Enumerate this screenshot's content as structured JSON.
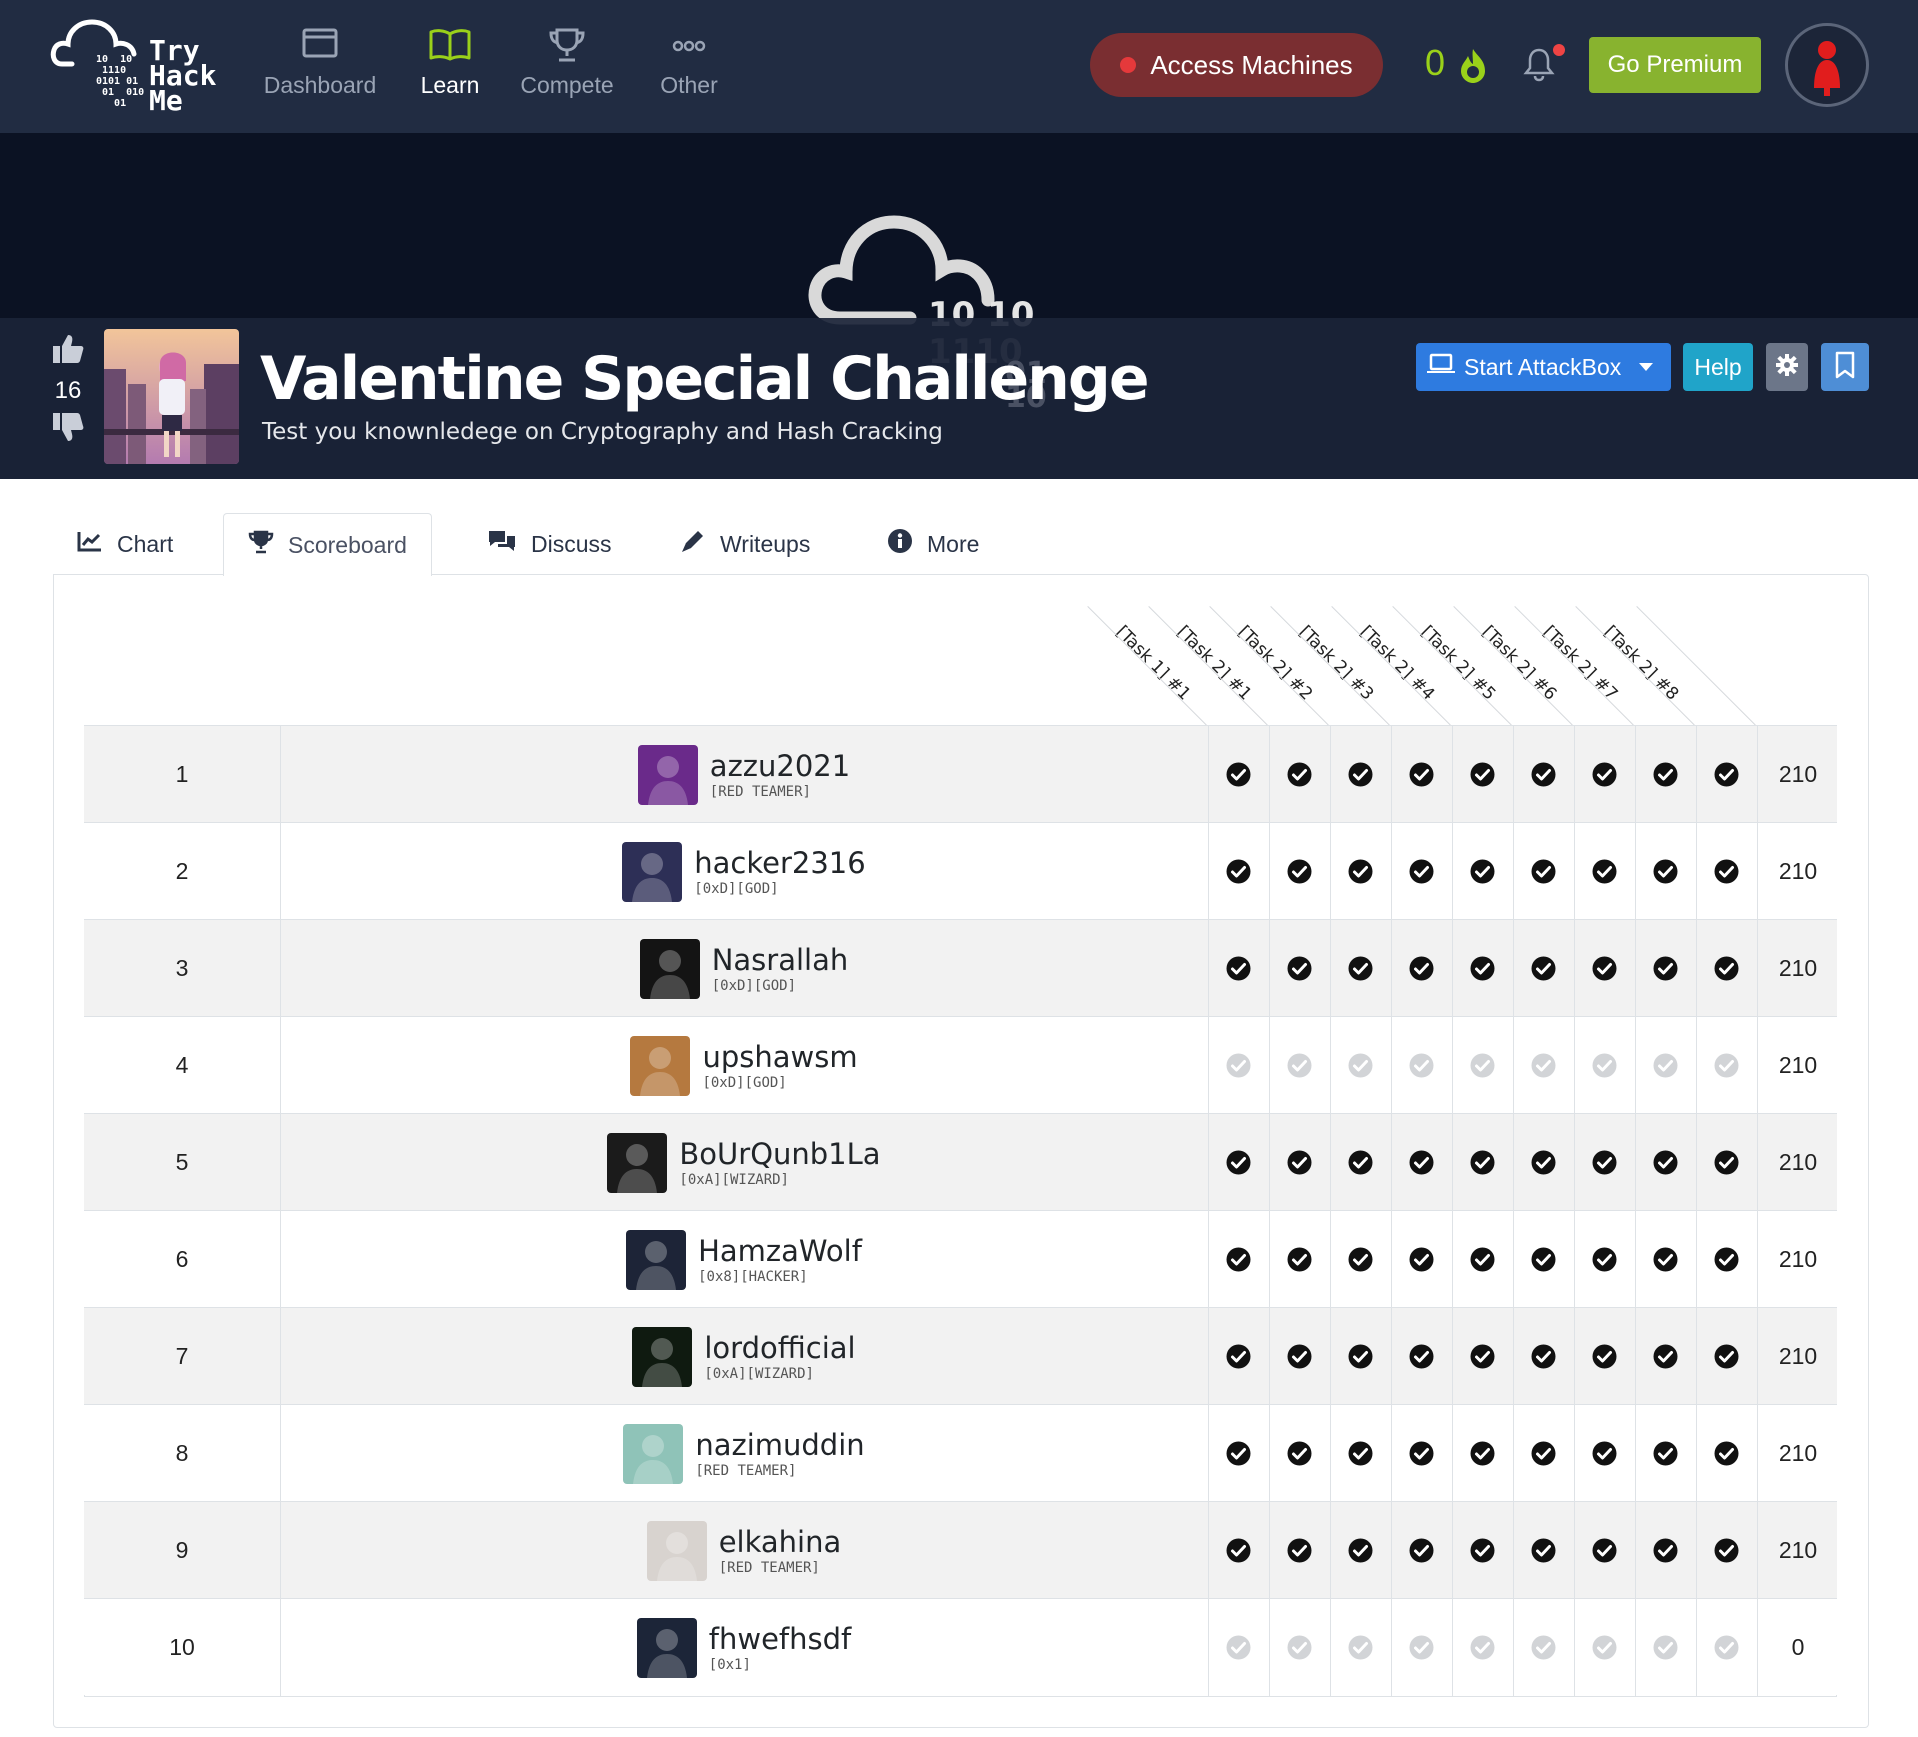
{
  "app": {
    "logo_text": [
      "Try",
      "Hack",
      "Me"
    ],
    "logo_bits": "10  10\n 1110\n0101 01\n 01  010\n   01"
  },
  "nav": {
    "items": [
      {
        "label": "Dashboard",
        "icon": "dashboard-icon",
        "active": false
      },
      {
        "label": "Learn",
        "icon": "book-icon",
        "active": true
      },
      {
        "label": "Compete",
        "icon": "trophy-icon",
        "active": false
      },
      {
        "label": "Other",
        "icon": "ellipsis-icon",
        "active": false
      }
    ],
    "access_machines": "Access Machines",
    "streak": "0",
    "go_premium": "Go Premium"
  },
  "room": {
    "title": "Valentine Special Challenge",
    "subtitle": "Test you knownledege on Cryptography and Hash Cracking",
    "votes": "16",
    "start_attackbox": "Start AttackBox",
    "help": "Help",
    "banner_bits": [
      "10  10",
      "1110",
      "01",
      "10"
    ]
  },
  "tabs": [
    {
      "label": "Chart",
      "icon": "chart-line-icon",
      "active": false
    },
    {
      "label": "Scoreboard",
      "icon": "trophy-icon",
      "active": true
    },
    {
      "label": "Discuss",
      "icon": "comments-icon",
      "active": false
    },
    {
      "label": "Writeups",
      "icon": "pen-icon",
      "active": false
    },
    {
      "label": "More",
      "icon": "info-circle-icon",
      "active": false
    }
  ],
  "scoreboard": {
    "columns": [
      "[Task 1] #1",
      "[Task 2] #1",
      "[Task 2] #2",
      "[Task 2] #3",
      "[Task 2] #4",
      "[Task 2] #5",
      "[Task 2] #6",
      "[Task 2] #7",
      "[Task 2] #8"
    ],
    "rows": [
      {
        "rank": "1",
        "username": "azzu2021",
        "title": "[RED TEAMER]",
        "completed": true,
        "score": "210",
        "avatar_color": "#6a2a8a"
      },
      {
        "rank": "2",
        "username": "hacker2316",
        "title": "[0xD][GOD]",
        "completed": true,
        "score": "210",
        "avatar_color": "#2d2f56"
      },
      {
        "rank": "3",
        "username": "Nasrallah",
        "title": "[0xD][GOD]",
        "completed": true,
        "score": "210",
        "avatar_color": "#141414"
      },
      {
        "rank": "4",
        "username": "upshawsm",
        "title": "[0xD][GOD]",
        "completed": false,
        "score": "210",
        "avatar_color": "#b5793f"
      },
      {
        "rank": "5",
        "username": "BoUrQunb1La",
        "title": "[0xA][WIZARD]",
        "completed": true,
        "score": "210",
        "avatar_color": "#1b1b1b"
      },
      {
        "rank": "6",
        "username": "HamzaWolf",
        "title": "[0x8][HACKER]",
        "completed": true,
        "score": "210",
        "avatar_color": "#1d2437"
      },
      {
        "rank": "7",
        "username": "lordofficial",
        "title": "[0xA][WIZARD]",
        "completed": true,
        "score": "210",
        "avatar_color": "#0f1a10"
      },
      {
        "rank": "8",
        "username": "nazimuddin",
        "title": "[RED TEAMER]",
        "completed": true,
        "score": "210",
        "avatar_color": "#8fc3b8"
      },
      {
        "rank": "9",
        "username": "elkahina",
        "title": "[RED TEAMER]",
        "completed": true,
        "score": "210",
        "avatar_color": "#d8d3cf"
      },
      {
        "rank": "10",
        "username": "fhwefhsdf",
        "title": "[0x1]",
        "completed": false,
        "score": "0",
        "avatar_color": "#1c2538"
      }
    ]
  }
}
